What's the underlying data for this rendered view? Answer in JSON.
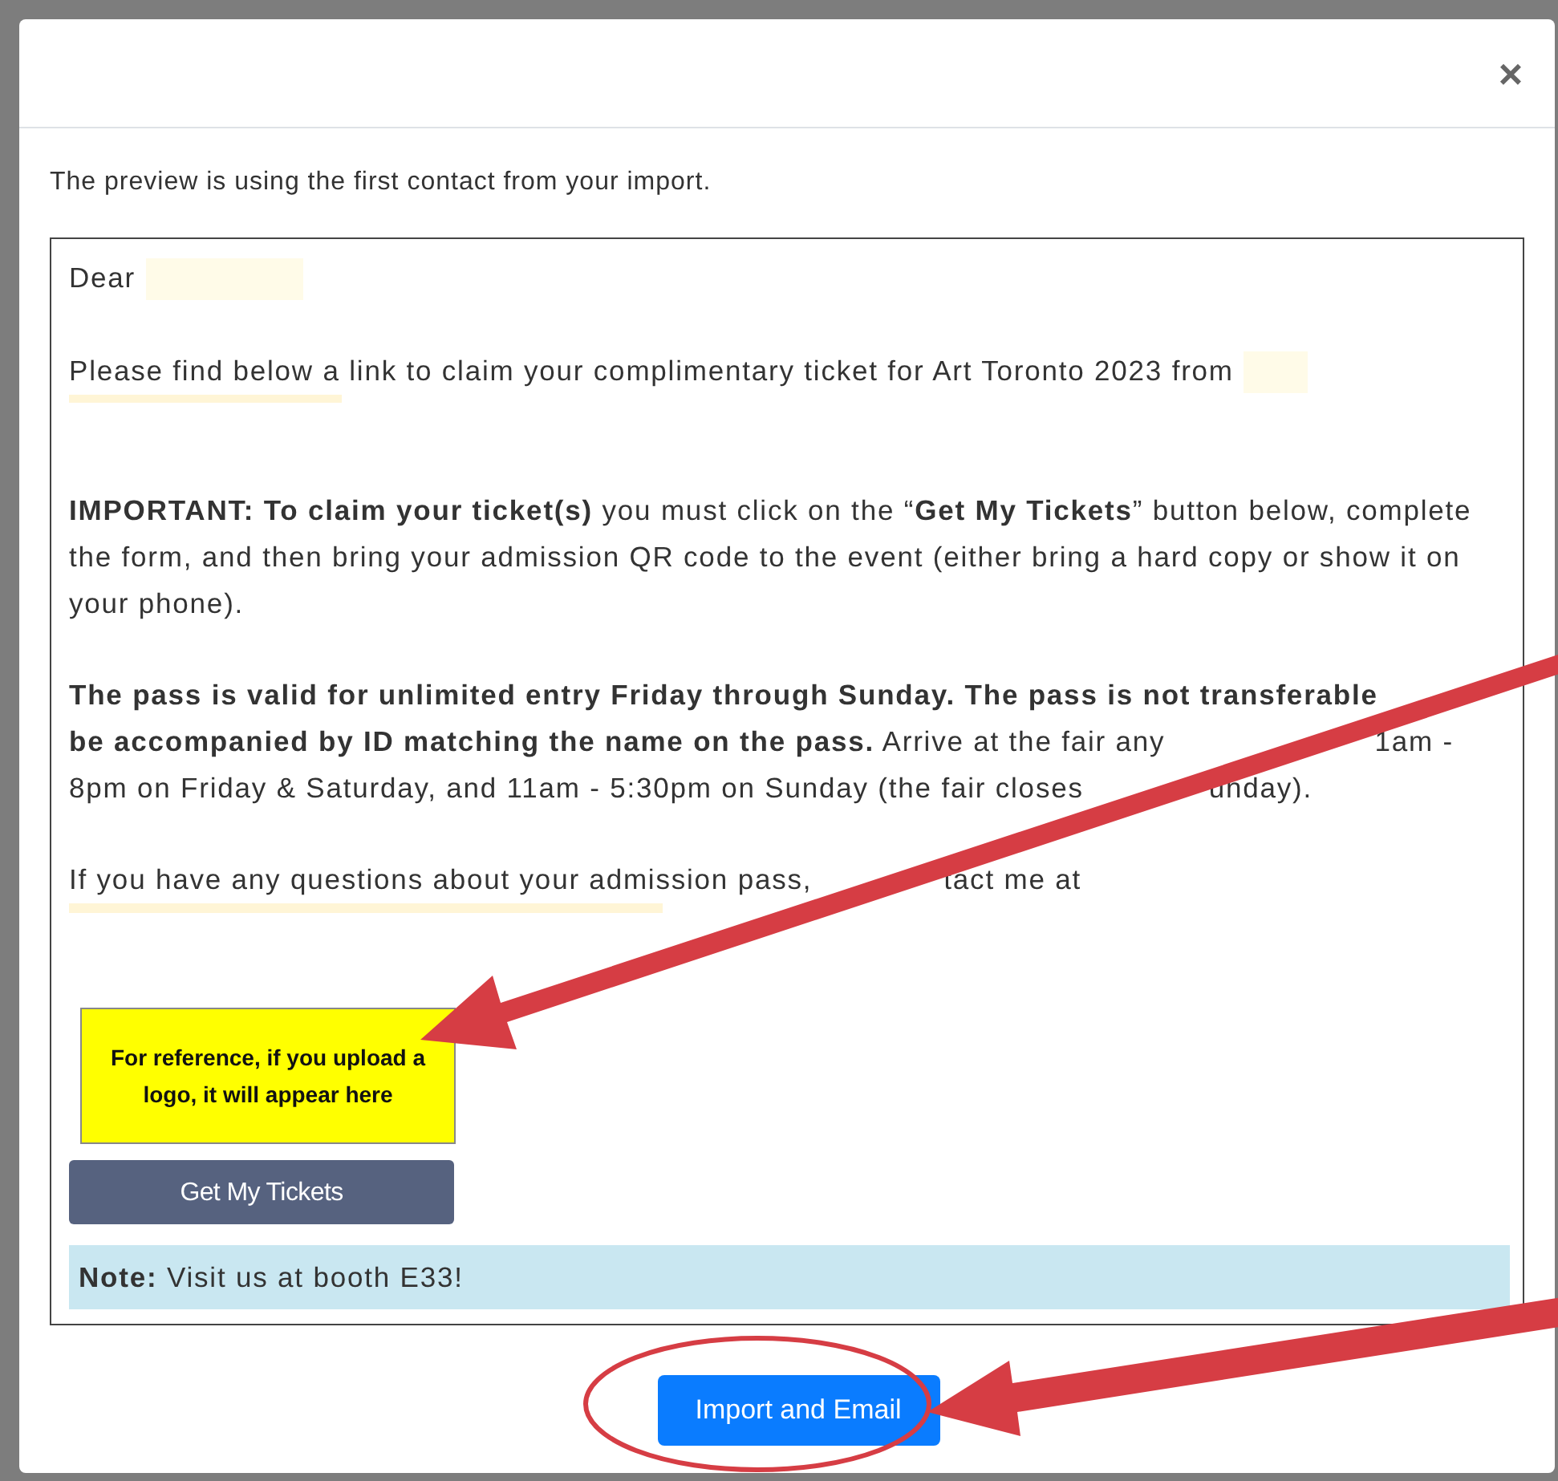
{
  "dialog": {
    "close": "×",
    "intro": "The preview is using the first contact from your import.",
    "preview": {
      "greeting": "Dear",
      "lead": "Please find below a link to claim your complimentary ticket for Art Toronto 2023 from",
      "paragraphs": [
        {
          "lines": [
            [
              "**IMPORTANT: To claim your ticket(s)** you must click on the “**Get My Tickets**” button below, complete"
            ],
            [
              "the form, and then bring your admission QR code to the event (either bring a hard copy or show it on"
            ],
            [
              "your phone)."
            ]
          ]
        },
        {
          "lines": [
            [
              "**The pass is valid for unlimited entry Friday through Sunday. The pass is not transferable**"
            ],
            [
              "**be accompanied by ID matching the name on the pass.** Arrive at the fair any",
              "1am -"
            ],
            [
              "8pm on Friday & Saturday, and 11am - 5:30pm on Sunday (the fair closes",
              "unday)."
            ]
          ]
        },
        {
          "lines": [
            [
              "If you have any questions about your admission pass,",
              "tact me at"
            ]
          ]
        }
      ],
      "logo_placeholder": "For reference, if you upload a logo, it will appear here",
      "button": "Get My Tickets",
      "note": "**Note:** Visit us at booth E33!"
    },
    "primary_button": "Import and Email"
  }
}
